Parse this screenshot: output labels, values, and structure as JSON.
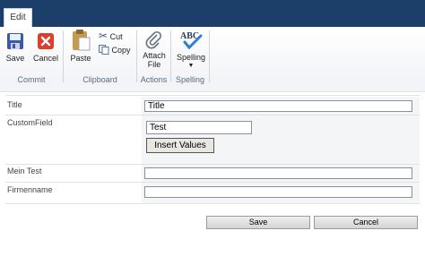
{
  "ribbon": {
    "tab": "Edit",
    "save": "Save",
    "cancel": "Cancel",
    "paste": "Paste",
    "cut": "Cut",
    "copy": "Copy",
    "attach_line1": "Attach",
    "attach_line2": "File",
    "spelling": "Spelling",
    "groups": {
      "commit": "Commit",
      "clipboard": "Clipboard",
      "actions": "Actions",
      "spelling": "Spelling"
    }
  },
  "form": {
    "title_label": "Title",
    "title_value": "Title",
    "customfield_label": "CustomField",
    "customfield_value": "Test",
    "insert_button": "Insert Values",
    "meintest_label": "Mein Test",
    "meintest_value": "",
    "firmenname_label": "Firmenname",
    "firmenname_value": ""
  },
  "footer": {
    "save": "Save",
    "cancel": "Cancel"
  }
}
